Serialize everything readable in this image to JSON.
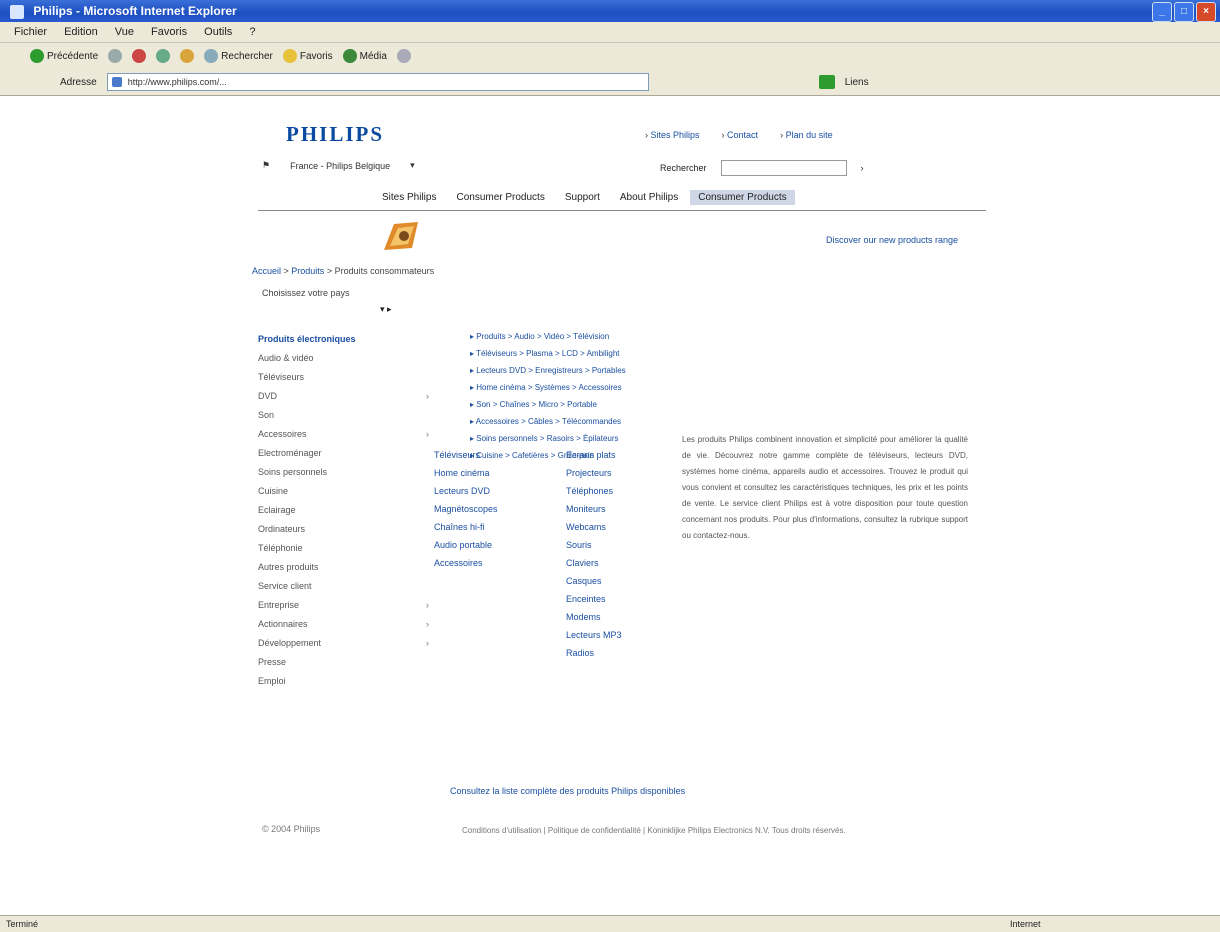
{
  "window": {
    "title": "Philips - Microsoft Internet Explorer",
    "min": "_",
    "max": "□",
    "close": "×"
  },
  "menubar": {
    "items": [
      "Fichier",
      "Edition",
      "Vue",
      "Favoris",
      "Outils",
      "?"
    ]
  },
  "toolbar": {
    "back": "Précédente",
    "search": "Rechercher",
    "favorites": "Favoris",
    "media": "Média",
    "address_label": "Adresse",
    "address_value": "http://www.philips.com/...",
    "links": "Liens"
  },
  "site": {
    "logo": "PHILIPS",
    "top_links": [
      "Sites Philips",
      "Contact",
      "Plan du site"
    ],
    "country": "France - Philips Belgique",
    "search_label": "Rechercher",
    "search_placeholder": "",
    "nav": [
      "Sites Philips",
      "Consumer Products",
      "Support",
      "About Philips",
      "Consumer Products"
    ],
    "nav_active_index": 4,
    "promo": "Discover our new products range",
    "breadcrumb": {
      "home": "Accueil",
      "sep1": " > ",
      "section": "Produits",
      "sep2": " > ",
      "current": "Produits consommateurs"
    },
    "selector": "Choisissez votre pays",
    "sidebar": [
      "Produits électroniques",
      "Audio & vidéo",
      "Téléviseurs",
      "DVD",
      "Son",
      "Accessoires",
      "Electroménager",
      "Soins personnels",
      "Cuisine",
      "Eclairage",
      "Ordinateurs",
      "Téléphonie",
      "Autres produits",
      "Service client",
      "Entreprise",
      "Actionnaires",
      "Développement",
      "Presse",
      "Emploi"
    ],
    "menu_col1": [
      "Téléviseurs",
      "Home cinéma",
      "Lecteurs DVD",
      "Magnétoscopes",
      "Chaînes hi-fi",
      "Audio portable",
      "Accessoires"
    ],
    "menu_col2": [
      "Ecrans plats",
      "Projecteurs",
      "Téléphones",
      "Moniteurs",
      "Webcams",
      "Souris",
      "Claviers",
      "Casques",
      "Enceintes",
      "Modems",
      "Lecteurs MP3",
      "Radios"
    ],
    "tree": [
      "▸ Produits > Audio > Vidéo > Télévision",
      "▸ Téléviseurs > Plasma > LCD > Ambilight",
      "▸ Lecteurs DVD > Enregistreurs > Portables",
      "▸ Home cinéma > Systèmes > Accessoires",
      "▸ Son > Chaînes > Micro > Portable",
      "▸ Accessoires > Câbles > Télécommandes",
      "▸ Soins personnels > Rasoirs > Épilateurs",
      "▸ Cuisine > Cafetières > Grille-pain"
    ],
    "paragraph": "Les produits Philips combinent innovation et simplicité pour améliorer la qualité de vie. Découvrez notre gamme complète de téléviseurs, lecteurs DVD, systèmes home cinéma, appareils audio et accessoires. Trouvez le produit qui vous convient et consultez les caractéristiques techniques, les prix et les points de vente. Le service client Philips est à votre disposition pour toute question concernant nos produits. Pour plus d'informations, consultez la rubrique support ou contactez-nous.",
    "bottom_link": "Consultez la liste complète des produits Philips disponibles",
    "footer_left": "© 2004 Philips",
    "footer_text": "Conditions d'utilisation | Politique de confidentialité | Koninklijke Philips Electronics N.V. Tous droits réservés."
  },
  "status": {
    "left": "Terminé",
    "zone": "Internet"
  }
}
